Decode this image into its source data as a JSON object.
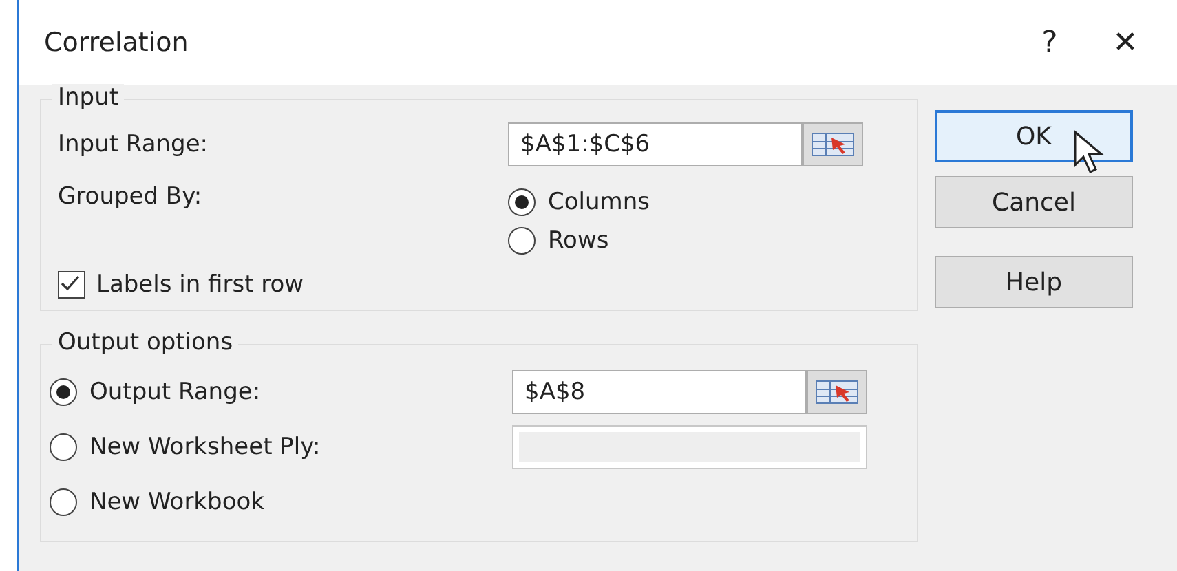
{
  "window": {
    "title": "Correlation",
    "help_glyph": "?",
    "close_glyph": "✕"
  },
  "input": {
    "legend": "Input",
    "range_label": "Input Range:",
    "range_value": "$A$1:$C$6",
    "grouped_label": "Grouped By:",
    "grouped_options": [
      {
        "label": "Columns",
        "selected": true
      },
      {
        "label": "Rows",
        "selected": false
      }
    ],
    "labels_checkbox": {
      "label": "Labels in first row",
      "checked": true
    }
  },
  "output": {
    "legend": "Output options",
    "options": [
      {
        "label": "Output Range:",
        "selected": true,
        "field": {
          "value": "$A$8",
          "disabled": false,
          "ref_button": true
        }
      },
      {
        "label": "New Worksheet Ply:",
        "selected": false,
        "field": {
          "disabled": true
        }
      },
      {
        "label": "New Workbook",
        "selected": false
      }
    ]
  },
  "buttons": [
    {
      "label": "OK",
      "focused": true,
      "pointer_over": true
    },
    {
      "label": "Cancel",
      "focused": false,
      "pointer_over": false
    },
    {
      "label": "Help",
      "focused": false,
      "pointer_over": false
    }
  ]
}
